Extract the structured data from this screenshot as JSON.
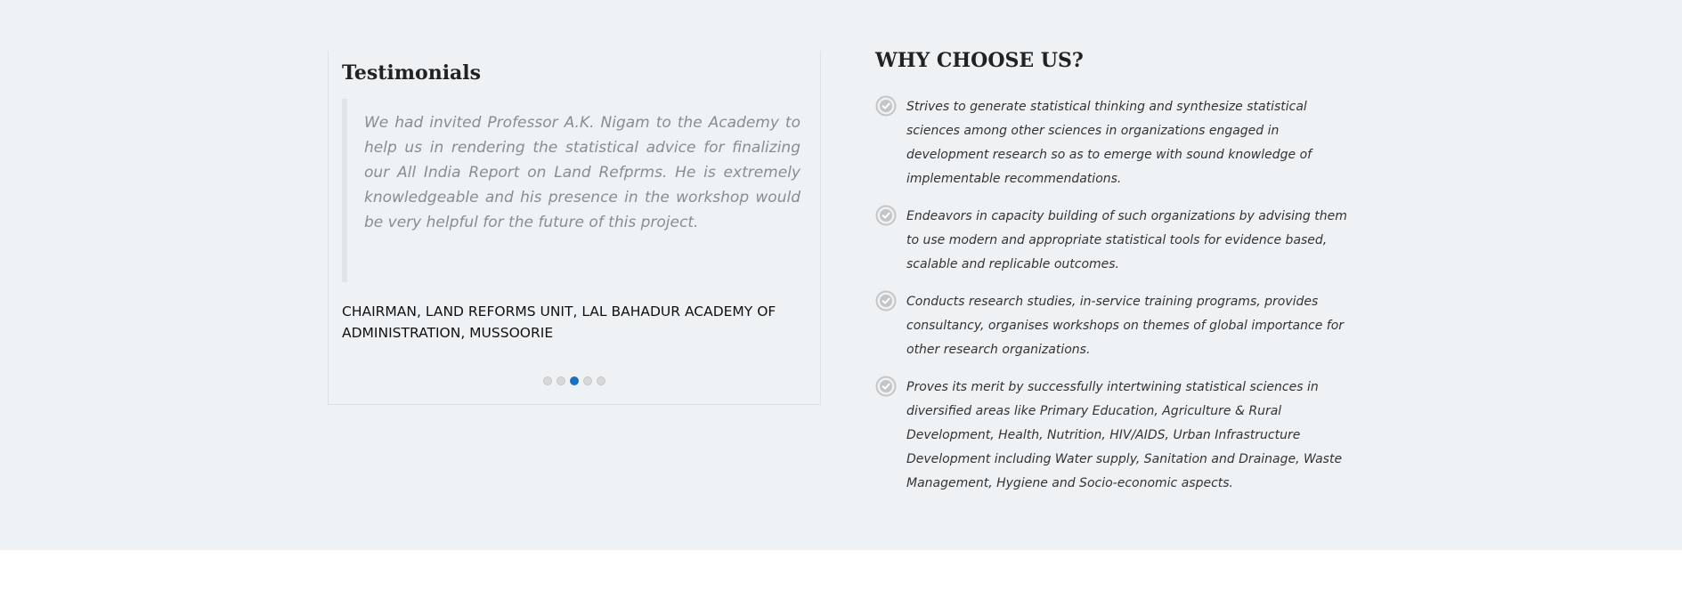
{
  "testimonials": {
    "title": "Testimonials",
    "quote": "We had invited Professor A.K. Nigam to the Academy to help us in rendering the statistical advice for finalizing our All India Report on Land Refprms. He is extremely knowledgeable and his presence in the workshop would be very helpful for the future of this project.",
    "author": "CHAIRMAN, LAND REFORMS UNIT, LAL BAHADUR ACADEMY OF ADMINISTRATION, MUSSOORIE",
    "slides_total": 5,
    "active_slide": 3
  },
  "why_choose": {
    "title": "WHY CHOOSE US?",
    "items": [
      {
        "icon": "check-circle-icon",
        "text": "Strives to generate statistical thinking and synthesize statistical sciences among other sciences in organizations engaged in development research so as to emerge with sound knowledge of implementable recommendations."
      },
      {
        "icon": "check-circle-icon",
        "text": "Endeavors in capacity building of such organizations by advising them to use modern and appropriate statistical tools for evidence based, scalable and replicable outcomes."
      },
      {
        "icon": "check-circle-icon",
        "text": "Conducts research studies, in-service training programs, provides consultancy, organises workshops on themes of global importance for other research organizations."
      },
      {
        "icon": "check-circle-icon",
        "text": "Proves its merit by successfully intertwining statistical sciences in diversified areas like Primary Education, Agriculture & Rural Development, Health, Nutrition, HIV/AIDS, Urban Infrastructure Development including Water supply, Sanitation and Drainage, Waste Management, Hygiene and Socio-economic aspects."
      }
    ]
  },
  "colors": {
    "section_bg": "#eff2f5",
    "accent_dot": "#1a6fc4",
    "quote_text": "#8a8d90",
    "check_icon": "#c3c5c7"
  }
}
